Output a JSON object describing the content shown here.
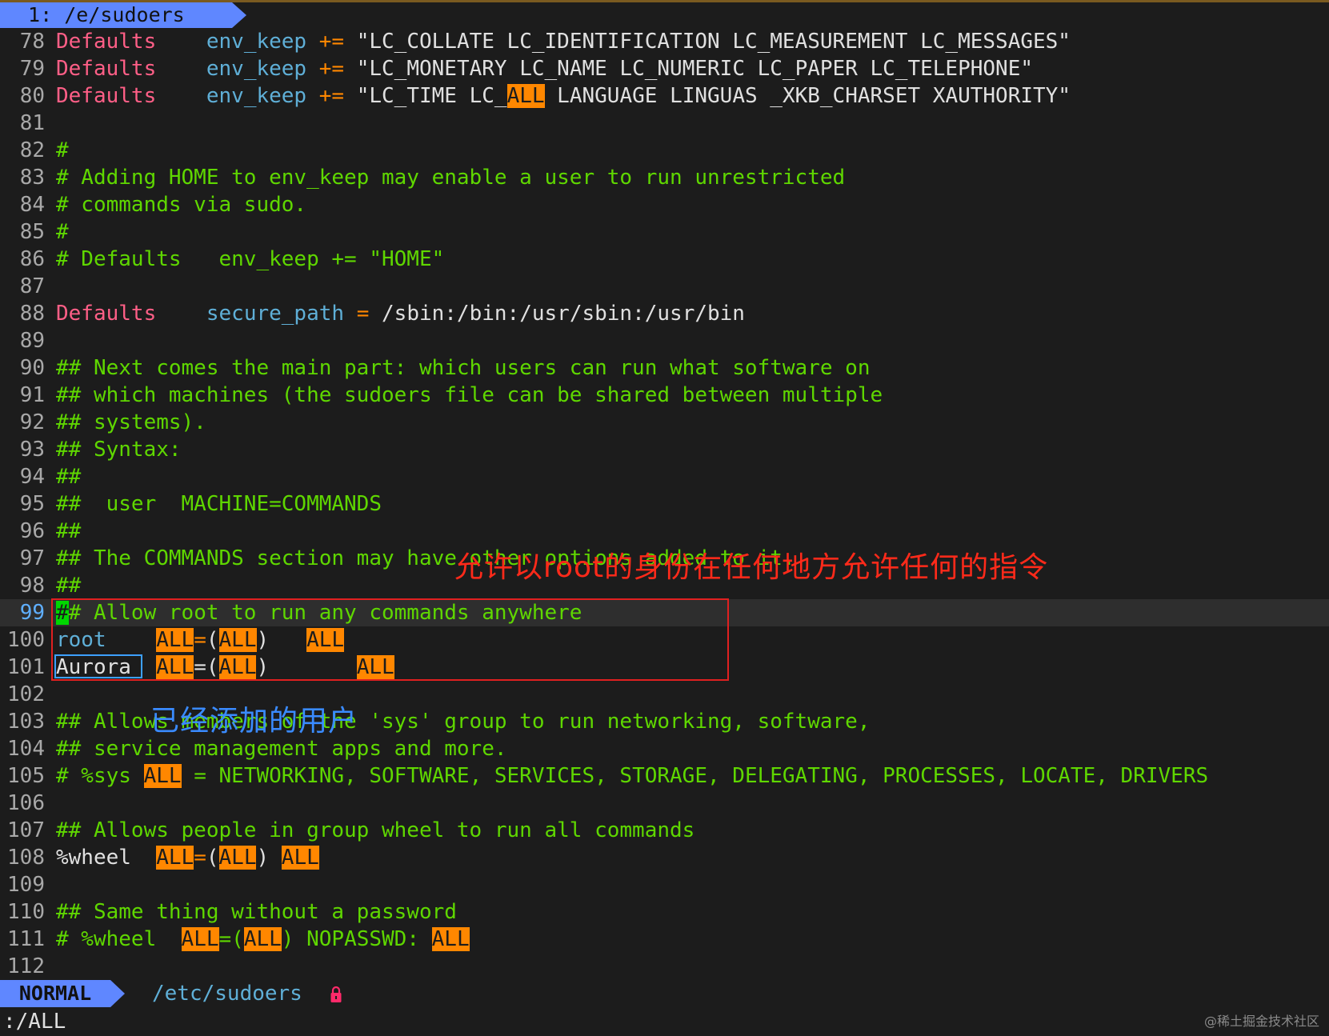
{
  "tabline": {
    "tab_label": " 1: /e/sudoers"
  },
  "lines": [
    {
      "num": "78",
      "segs": [
        [
          "kw",
          "Defaults"
        ],
        [
          "txt",
          "    "
        ],
        [
          "var",
          "env_keep"
        ],
        [
          "txt",
          " "
        ],
        [
          "op",
          "+="
        ],
        [
          "txt",
          " \"LC_COLLATE LC_IDENTIFICATION LC_MEASUREMENT LC_MESSAGES\""
        ]
      ]
    },
    {
      "num": "79",
      "segs": [
        [
          "kw",
          "Defaults"
        ],
        [
          "txt",
          "    "
        ],
        [
          "var",
          "env_keep"
        ],
        [
          "txt",
          " "
        ],
        [
          "op",
          "+="
        ],
        [
          "txt",
          " \"LC_MONETARY LC_NAME LC_NUMERIC LC_PAPER LC_TELEPHONE\""
        ]
      ]
    },
    {
      "num": "80",
      "segs": [
        [
          "kw",
          "Defaults"
        ],
        [
          "txt",
          "    "
        ],
        [
          "var",
          "env_keep"
        ],
        [
          "txt",
          " "
        ],
        [
          "op",
          "+="
        ],
        [
          "txt",
          " \"LC_TIME LC_"
        ],
        [
          "hl",
          "ALL"
        ],
        [
          "txt",
          " LANGUAGE LINGUAS _XKB_CHARSET XAUTHORITY\""
        ]
      ]
    },
    {
      "num": "81",
      "segs": []
    },
    {
      "num": "82",
      "segs": [
        [
          "cm",
          "#"
        ]
      ]
    },
    {
      "num": "83",
      "segs": [
        [
          "cm",
          "# Adding HOME to env_keep may enable a user to run unrestricted"
        ]
      ]
    },
    {
      "num": "84",
      "segs": [
        [
          "cm",
          "# commands via sudo."
        ]
      ]
    },
    {
      "num": "85",
      "segs": [
        [
          "cm",
          "#"
        ]
      ]
    },
    {
      "num": "86",
      "segs": [
        [
          "cm",
          "# Defaults   env_keep += \"HOME\""
        ]
      ]
    },
    {
      "num": "87",
      "segs": []
    },
    {
      "num": "88",
      "segs": [
        [
          "kw",
          "Defaults"
        ],
        [
          "txt",
          "    "
        ],
        [
          "var",
          "secure_path"
        ],
        [
          "txt",
          " "
        ],
        [
          "op",
          "="
        ],
        [
          "txt",
          " /sbin:/bin:/usr/sbin:/usr/bin"
        ]
      ]
    },
    {
      "num": "89",
      "segs": []
    },
    {
      "num": "90",
      "segs": [
        [
          "cm",
          "## Next comes the main part: which users can run what software on"
        ]
      ]
    },
    {
      "num": "91",
      "segs": [
        [
          "cm",
          "## which machines (the sudoers file can be shared between multiple"
        ]
      ]
    },
    {
      "num": "92",
      "segs": [
        [
          "cm",
          "## systems)."
        ]
      ]
    },
    {
      "num": "93",
      "segs": [
        [
          "cm",
          "## Syntax:"
        ]
      ]
    },
    {
      "num": "94",
      "segs": [
        [
          "cm",
          "##"
        ]
      ]
    },
    {
      "num": "95",
      "segs": [
        [
          "cm",
          "##  user  MACHINE=COMMANDS"
        ]
      ]
    },
    {
      "num": "96",
      "segs": [
        [
          "cm",
          "##"
        ]
      ]
    },
    {
      "num": "97",
      "segs": [
        [
          "cm",
          "## The COMMANDS section may have other options added to it."
        ]
      ]
    },
    {
      "num": "98",
      "segs": [
        [
          "cm",
          "##"
        ]
      ]
    },
    {
      "num": "99",
      "current": true,
      "segs": [
        [
          "cursor",
          "#"
        ],
        [
          "cm",
          "# Allow root to run any commands anywhere"
        ]
      ]
    },
    {
      "num": "100",
      "segs": [
        [
          "var",
          "root"
        ],
        [
          "txt",
          "    "
        ],
        [
          "hl",
          "ALL"
        ],
        [
          "op",
          "="
        ],
        [
          "txt",
          "("
        ],
        [
          "hl",
          "ALL"
        ],
        [
          "txt",
          ")   "
        ],
        [
          "hl",
          "ALL"
        ]
      ]
    },
    {
      "num": "101",
      "segs": [
        [
          "txt",
          "Aurora  "
        ],
        [
          "hl",
          "ALL"
        ],
        [
          "txt",
          "=("
        ],
        [
          "hl",
          "ALL"
        ],
        [
          "txt",
          ")       "
        ],
        [
          "hl",
          "ALL"
        ]
      ]
    },
    {
      "num": "102",
      "segs": []
    },
    {
      "num": "103",
      "segs": [
        [
          "cm",
          "## Allows members of the 'sys' group to run networking, software,"
        ]
      ]
    },
    {
      "num": "104",
      "segs": [
        [
          "cm",
          "## service management apps and more."
        ]
      ]
    },
    {
      "num": "105",
      "segs": [
        [
          "cm",
          "# %sys "
        ],
        [
          "hl",
          "ALL"
        ],
        [
          "cm",
          " = NETWORKING, SOFTWARE, SERVICES, STORAGE, DELEGATING, PROCESSES, LOCATE, DRIVERS"
        ]
      ]
    },
    {
      "num": "106",
      "segs": []
    },
    {
      "num": "107",
      "segs": [
        [
          "cm",
          "## Allows people in group wheel to run all commands"
        ]
      ]
    },
    {
      "num": "108",
      "segs": [
        [
          "txt",
          "%wheel  "
        ],
        [
          "hl",
          "ALL"
        ],
        [
          "op",
          "="
        ],
        [
          "txt",
          "("
        ],
        [
          "hl",
          "ALL"
        ],
        [
          "txt",
          ") "
        ],
        [
          "hl",
          "ALL"
        ]
      ]
    },
    {
      "num": "109",
      "segs": []
    },
    {
      "num": "110",
      "segs": [
        [
          "cm",
          "## Same thing without a password"
        ]
      ]
    },
    {
      "num": "111",
      "segs": [
        [
          "cm",
          "# %wheel  "
        ],
        [
          "hl",
          "ALL"
        ],
        [
          "cm",
          "=("
        ],
        [
          "hl",
          "ALL"
        ],
        [
          "cm",
          ") NOPASSWD: "
        ],
        [
          "hl",
          "ALL"
        ]
      ]
    },
    {
      "num": "112",
      "segs": []
    }
  ],
  "annotations": {
    "red_note": "允许以root的身份在任何地方允许任何的指令",
    "blue_note": "已经添加的用户"
  },
  "statusline": {
    "mode": "NORMAL",
    "file": "/etc/sudoers",
    "lock_icon": "lock-icon"
  },
  "cmdline": ":/ALL",
  "watermark": "@稀土掘金技术社区",
  "colors": {
    "keyword": "#ff5f87",
    "variable": "#5fafd7",
    "comment": "#5fd700",
    "search_highlight": "#ff8700",
    "mode_bg": "#5f87ff",
    "annotation_red": "#ff2a1a",
    "annotation_blue": "#3a8bff"
  }
}
